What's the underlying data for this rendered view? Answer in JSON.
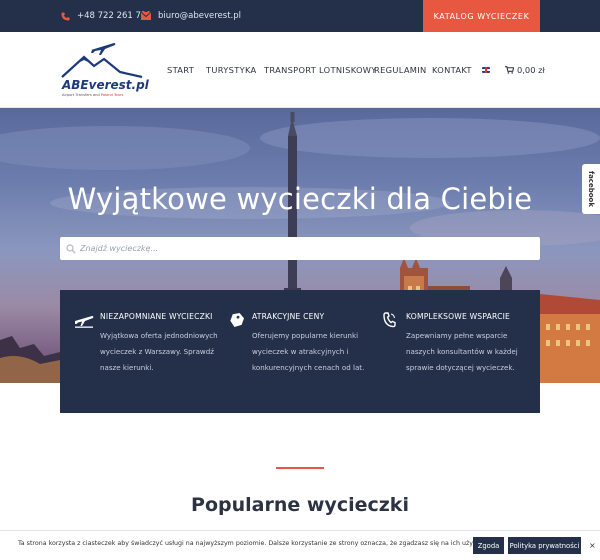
{
  "topbar": {
    "phone": "+48 722 261 731",
    "email": "biuro@abeverest.pl",
    "catalog_button": "KATALOG WYCIECZEK",
    "accent": "#e8573f",
    "background": "#24304a"
  },
  "logo": {
    "name": "ABEverest.pl",
    "tagline_prefix": "Airport Transfers and ",
    "tagline_highlight": "Poland Tours"
  },
  "nav": {
    "items": [
      "START",
      "TURYSTYKA",
      "TRANSPORT LOTNISKOWY",
      "REGULAMIN",
      "KONTAKT"
    ],
    "language_icon": "uk-flag-icon",
    "cart": "0,00 zł"
  },
  "hero": {
    "title": "Wyjątkowe wycieczki dla Ciebie",
    "search_placeholder": "Znajdź wycieczkę...",
    "facebook_tab": "facebook"
  },
  "features": [
    {
      "icon": "airplane-icon",
      "title": "NIEZAPOMNIANE WYCIECZKI",
      "text": "Wyjątkowa oferta jednodniowych wycieczek z Warszawy. Sprawdź nasze kierunki."
    },
    {
      "icon": "price-tag-icon",
      "title": "ATRAKCYJNE CENY",
      "text": "Oferujemy popularne kierunki wycieczek w atrakcyjnych i konkurencyjnych cenach od lat."
    },
    {
      "icon": "phone-icon",
      "title": "KOMPLEKSOWE WSPARCIE",
      "text": "Zapewniamy pełne wsparcie naszych konsultantów w każdej sprawie dotyczącej wycieczek."
    }
  ],
  "section": {
    "title": "Popularne wycieczki"
  },
  "cookie": {
    "text": "Ta strona korzysta z ciasteczek aby świadczyć usługi na najwyższym poziomie. Dalsze korzystanie ze strony oznacza, że zgadzasz się na ich użycie.",
    "agree_button": "Zgoda",
    "policy_button": "Polityka prywatności",
    "close": "×"
  }
}
